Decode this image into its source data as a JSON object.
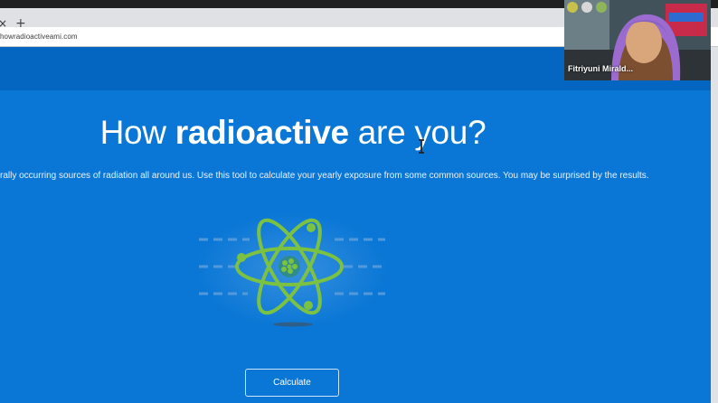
{
  "browser": {
    "tab_close": "×",
    "new_tab": "+",
    "url": "howradioactiveami.com"
  },
  "page": {
    "headline_pre": "How ",
    "headline_bold": "radioactive",
    "headline_post": " are you?",
    "intro": "rally occurring sources of radiation all around us. Use this tool to calculate your yearly exposure from some common sources. You may be surprised by the results.",
    "calculate_label": "Calculate"
  },
  "video": {
    "participant_name": "Fitriyuni Mirald..."
  },
  "colors": {
    "page_bg": "#0a77d6",
    "header_bg": "#0566c2",
    "atom_green": "#7cc242"
  },
  "icons": [
    "atom-illustration-icon",
    "text-cursor-icon"
  ]
}
